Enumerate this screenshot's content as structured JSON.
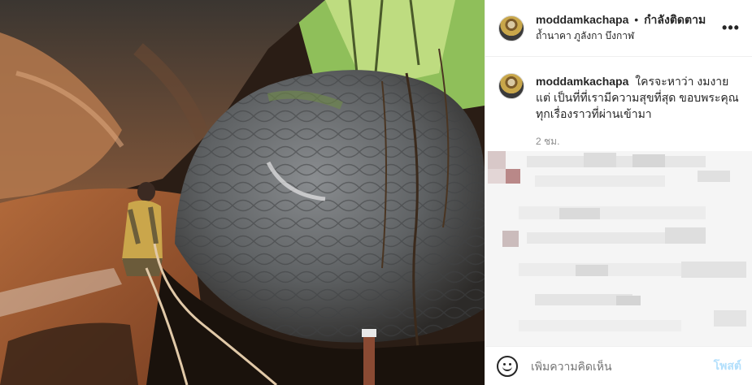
{
  "header": {
    "username": "moddamkachapa",
    "separator": "•",
    "follow_status": "กำลังติดตาม",
    "location": "ถ้ำนาคา ภูลังกา บึงกาฬ",
    "more_icon": "more-options-icon"
  },
  "caption": {
    "username": "moddamkachapa",
    "text": "ใครจะหาว่า งมงายแต่ เป็นที่ที่เรามีความสุขที่สุด ขอบพระคุณทุกเรื่องราวที่ผ่านเข้ามา",
    "timestamp": "2 ชม."
  },
  "comment_bar": {
    "emoji_icon": "emoji-icon",
    "placeholder": "เพิ่มความคิดเห็น",
    "post_label": "โพสต์"
  },
  "colors": {
    "accent_disabled": "#b2dffc",
    "secondary_text": "#8e8e8e",
    "primary_text": "#262626"
  }
}
